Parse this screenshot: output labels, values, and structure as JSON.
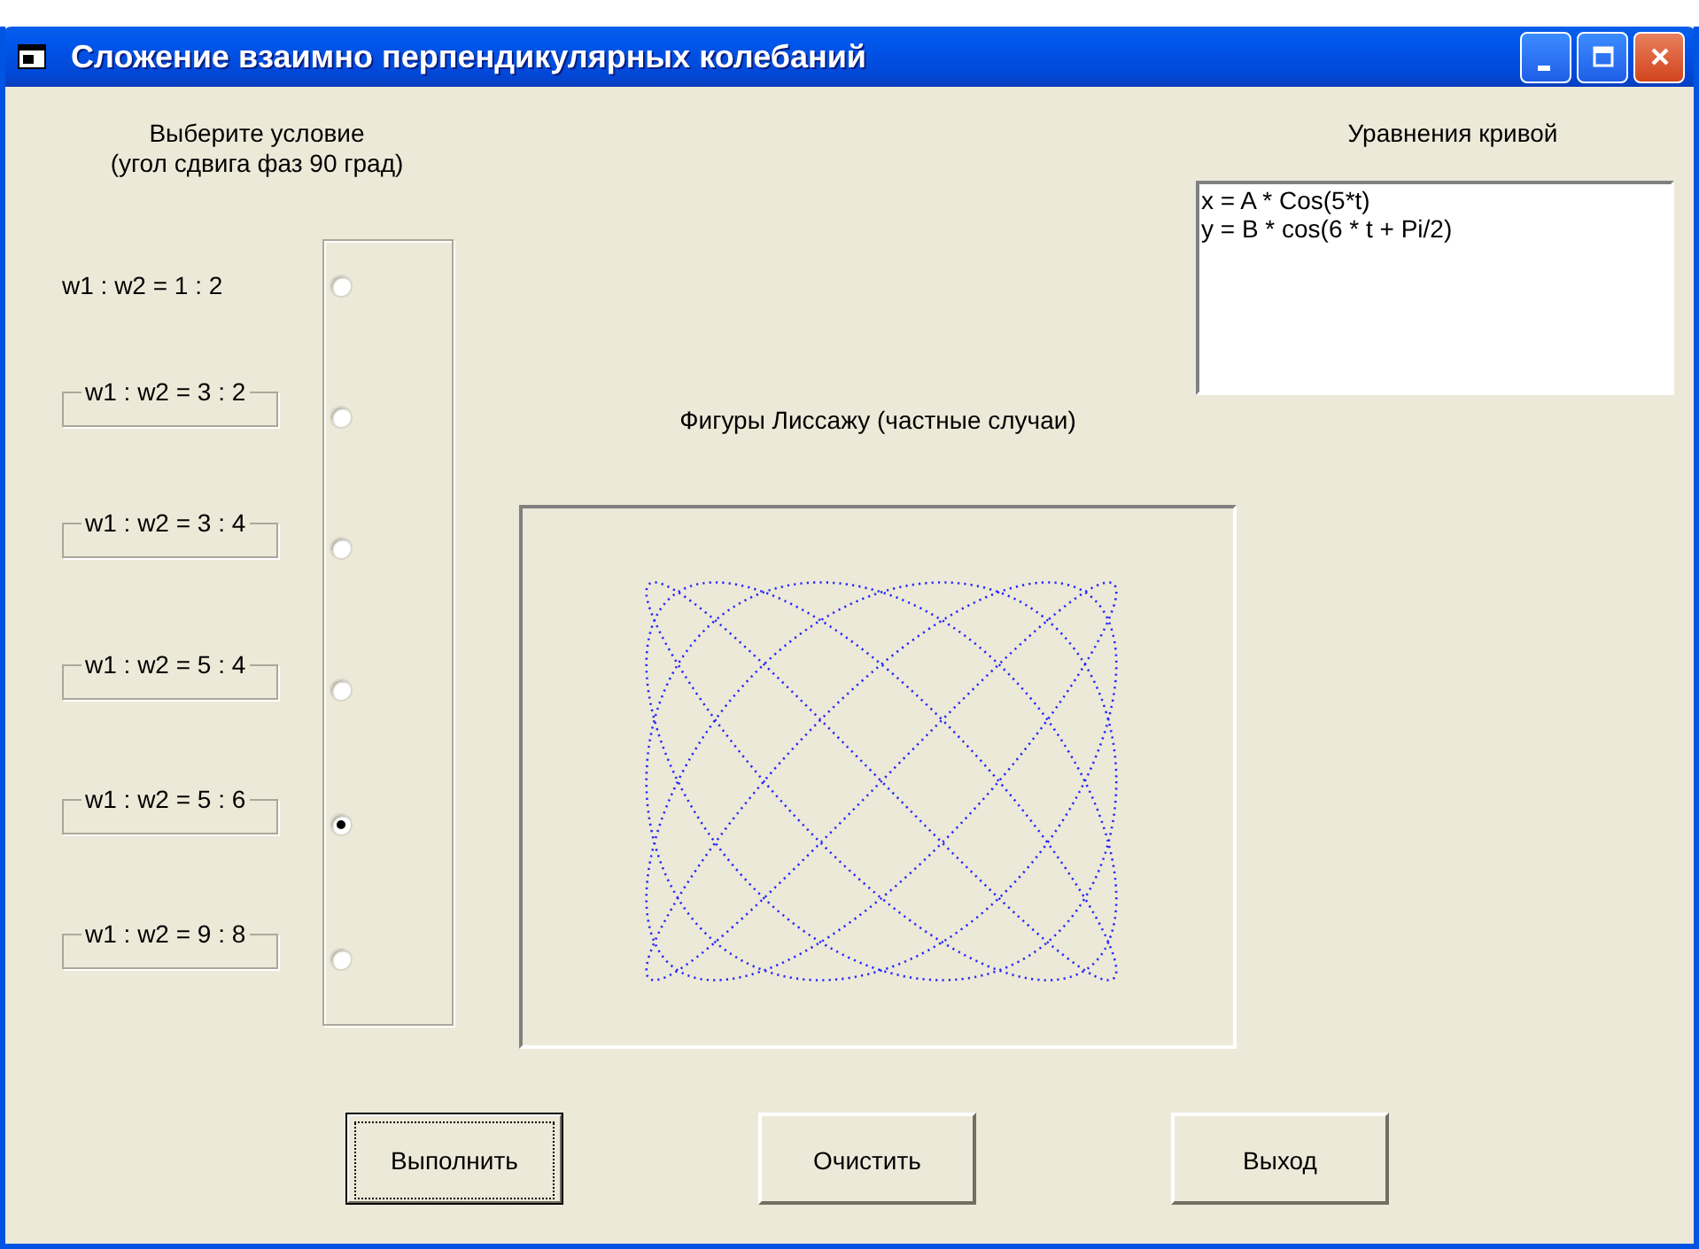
{
  "window": {
    "title": "Сложение взаимно перпендикулярных колебаний"
  },
  "condition_heading": [
    "Выберите условие",
    "(угол сдвига фаз 90 град)"
  ],
  "options": [
    {
      "label": "w1 : w2 = 1 : 2",
      "kind": "plain",
      "selected": false
    },
    {
      "label": "w1 : w2 = 3 : 2",
      "kind": "framed",
      "selected": false
    },
    {
      "label": "w1 : w2 = 3 : 4",
      "kind": "framed",
      "selected": false
    },
    {
      "label": "w1 : w2 = 5 : 4",
      "kind": "framed",
      "selected": false
    },
    {
      "label": "w1 : w2 = 5 : 6",
      "kind": "framed",
      "selected": true
    },
    {
      "label": "w1 : w2 = 9 : 8",
      "kind": "framed",
      "selected": false
    }
  ],
  "equations": {
    "heading": "Уравнения кривой",
    "lines": [
      "x = A * Cos(5*t)",
      "y = B * cos(6 * t + Pi/2)"
    ]
  },
  "figure": {
    "caption": "Фигуры Лиссажу (частные случаи)"
  },
  "buttons": [
    {
      "label": "Выполнить",
      "default": true
    },
    {
      "label": "Очистить",
      "default": false
    },
    {
      "label": "Выход",
      "default": false
    }
  ]
}
